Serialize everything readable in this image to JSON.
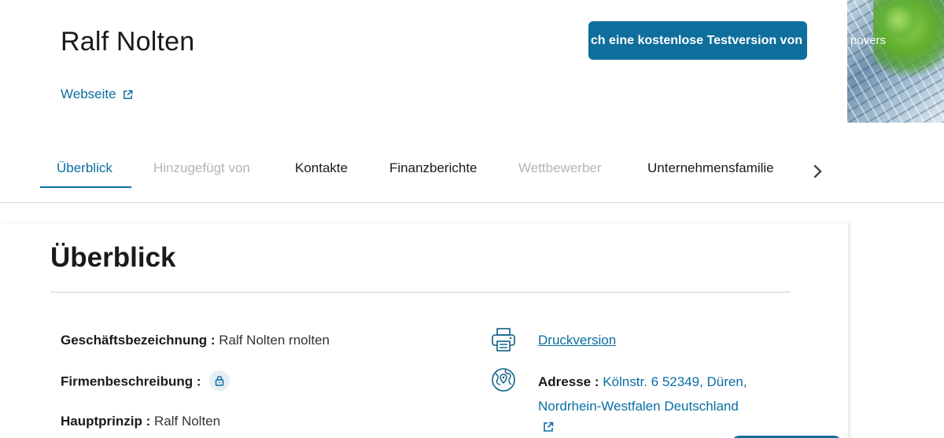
{
  "header": {
    "company_name": "Ralf Nolten",
    "website_label": "Webseite",
    "trial_button_label": "ch eine kostenlose Testversion von",
    "hero_text": "povers",
    "accent_color": "#0e6e9c"
  },
  "tabs": [
    {
      "label": "Überblick",
      "state": "active"
    },
    {
      "label": "Hinzugefügt von",
      "state": "disabled"
    },
    {
      "label": "Kontakte",
      "state": "normal"
    },
    {
      "label": "Finanzberichte",
      "state": "normal"
    },
    {
      "label": "Wettbewerber",
      "state": "disabled"
    },
    {
      "label": "Unternehmensfamilie",
      "state": "normal"
    }
  ],
  "overview": {
    "title": "Überblick",
    "business_name_label": "Geschäftsbezeichnung :",
    "business_name_value": "Ralf Nolten rnolten",
    "description_label": "Firmenbeschreibung :",
    "principal_label": "Hauptprinzip :",
    "principal_value": "Ralf Nolten",
    "print_label": "Druckversion",
    "address_label": "Adresse :",
    "address_value": "Kölnstr. 6 52349, Düren, Nordrhein-Westfalen Deutschland"
  },
  "icons": {
    "external_link": "external-link-icon",
    "next": "chevron-right-icon",
    "lock": "lock-icon",
    "printer": "printer-icon",
    "globe": "globe-location-icon"
  }
}
